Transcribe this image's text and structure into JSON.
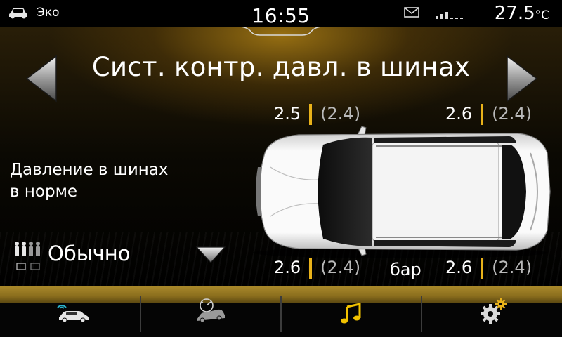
{
  "status_bar": {
    "mode_label": "Эко",
    "time": "16:55",
    "temperature_value": "27.5",
    "temperature_unit": "°C",
    "icons": [
      "car-mode-icon",
      "mail-icon",
      "signal-icon"
    ]
  },
  "main": {
    "title": "Сист. контр. давл. в шинах",
    "tires": {
      "front_left": {
        "current": "2.5",
        "reference": "(2.4)"
      },
      "front_right": {
        "current": "2.6",
        "reference": "(2.4)"
      },
      "rear_left": {
        "current": "2.6",
        "reference": "(2.4)"
      },
      "rear_right": {
        "current": "2.6",
        "reference": "(2.4)"
      }
    },
    "unit": "бар",
    "status_message_line1": "Давление в шинах",
    "status_message_line2": "в норме",
    "load_setting": {
      "selected": "Обычно"
    }
  },
  "dock": {
    "items": [
      {
        "icon": "car-assist-icon"
      },
      {
        "icon": "driving-data-icon"
      },
      {
        "icon": "music-note-icon"
      },
      {
        "icon": "settings-gears-icon"
      }
    ]
  },
  "colors": {
    "accent": "#e9b21a",
    "band": "#9a7b24",
    "background": "#000000",
    "reference_text": "#b9b9b9"
  }
}
